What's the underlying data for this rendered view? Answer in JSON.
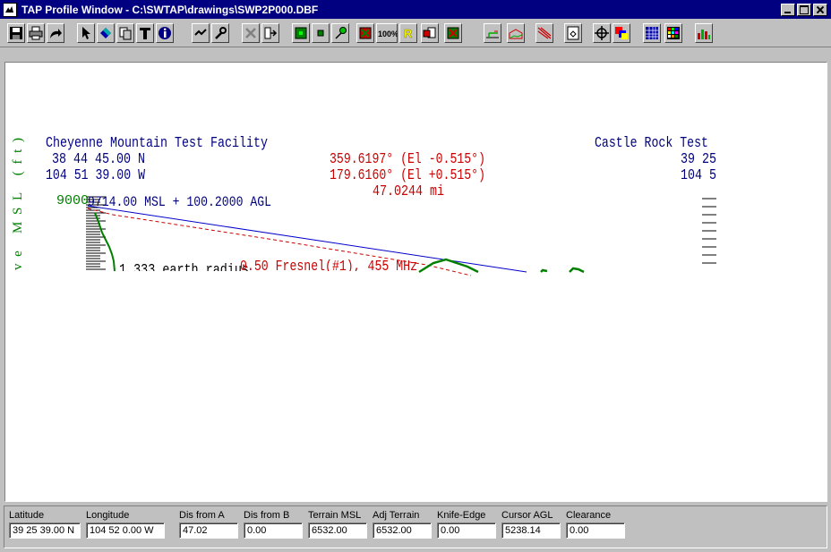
{
  "window": {
    "title": "TAP Profile Window - C:\\SWTAP\\drawings\\SWP2P000.DBF",
    "buttons": [
      "minimize-button",
      "maximize-button",
      "close-button"
    ]
  },
  "toolbar": {
    "buttons": [
      {
        "name": "save-icon"
      },
      {
        "name": "print-icon"
      },
      {
        "name": "redo-icon"
      },
      {
        "name": "pointer-icon"
      },
      {
        "name": "fill-icon"
      },
      {
        "name": "copy-icon"
      },
      {
        "name": "text-icon"
      },
      {
        "name": "info-icon"
      },
      {
        "name": "recalc-icon"
      },
      {
        "name": "tools-icon"
      },
      {
        "name": "delete-icon"
      },
      {
        "name": "export-icon"
      },
      {
        "name": "green-square-icon"
      },
      {
        "name": "green-dot-icon"
      },
      {
        "name": "pin-icon"
      },
      {
        "name": "red-square-icon"
      },
      {
        "name": "zoom-100-icon",
        "label": "100%"
      },
      {
        "name": "r-icon",
        "label": "R"
      },
      {
        "name": "red-doc-icon"
      },
      {
        "name": "green-doc-icon"
      },
      {
        "name": "terrain-rise-icon"
      },
      {
        "name": "terrain-profile-icon"
      },
      {
        "name": "slope-icon"
      },
      {
        "name": "page-icon"
      },
      {
        "name": "crosshair-icon"
      },
      {
        "name": "color-squares-icon"
      },
      {
        "name": "grid-blue-icon"
      },
      {
        "name": "grid-multi-icon"
      },
      {
        "name": "histogram-icon"
      }
    ]
  },
  "profile": {
    "site_a": {
      "name": "Cheyenne Mountain Test Facility",
      "lat": "38 44 45.00 N",
      "lon": "104 51 39.00 W"
    },
    "site_b": {
      "name": "Castle Rock Test",
      "lat": "39 25",
      "lon": "104 5"
    },
    "azimuth_a": "359.6197° (El -0.515°)",
    "azimuth_b": "179.6160° (El +0.515°)",
    "distance": "47.0244 mi",
    "antenna_a": "9714.00 MSL + 100.2000 AGL",
    "axis_label": "ve MSL (ft)",
    "y_top_tick": "9000",
    "earth_radius": "1.333 earth radius",
    "fresnel": "0.50 Fresnel(#1), 455 MHz",
    "colors": {
      "los": "#0000cc",
      "fresnel": "#cc0000",
      "terrain": "#008000",
      "text_blue": "#000080",
      "text_red": "#cc0000",
      "axis_green": "#008000"
    }
  },
  "status": {
    "fields": [
      {
        "label": "Latitude",
        "value": "39 25 39.00 N"
      },
      {
        "label": "Longitude",
        "value": "104 52 0.00 W"
      },
      {
        "label": "Dis from A",
        "value": "47.02"
      },
      {
        "label": "Dis from B",
        "value": "0.00"
      },
      {
        "label": "Terrain MSL",
        "value": "6532.00"
      },
      {
        "label": "Adj Terrain",
        "value": "6532.00"
      },
      {
        "label": "Knife-Edge",
        "value": "0.00"
      },
      {
        "label": "Cursor AGL",
        "value": "5238.14"
      },
      {
        "label": "Clearance",
        "value": "0.00"
      }
    ]
  }
}
